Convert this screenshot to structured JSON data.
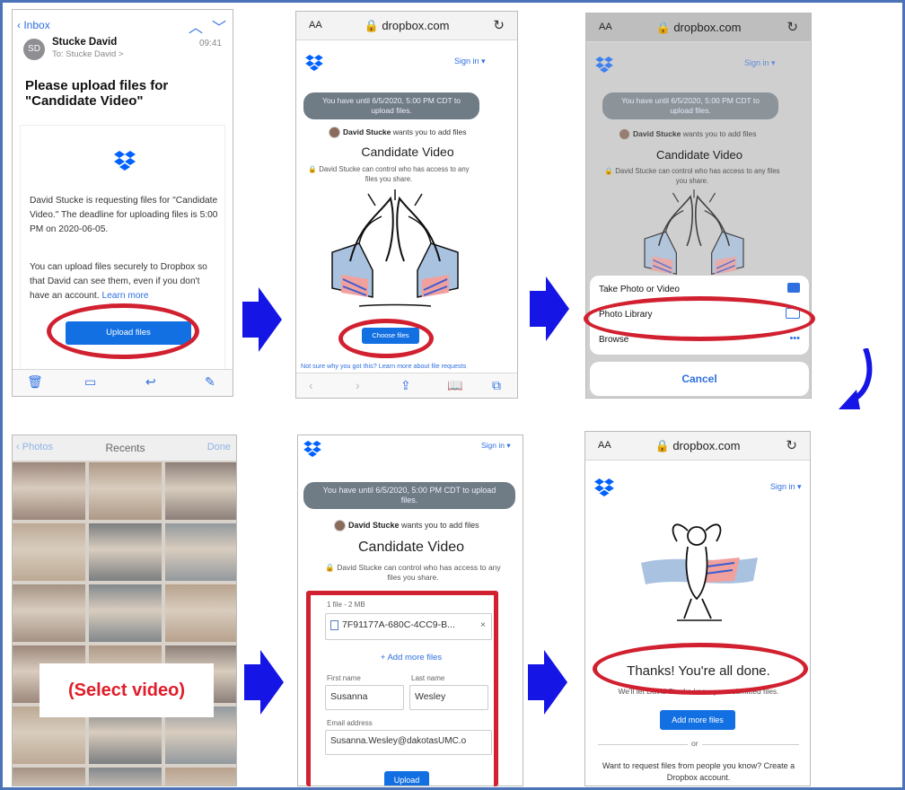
{
  "colors": {
    "accent": "#1270e3",
    "highlight": "#d1202f",
    "arrow": "#1515e6",
    "border": "#4c73b8"
  },
  "mail": {
    "back_label": "Inbox",
    "sender_initials": "SD",
    "sender": "Stucke David",
    "time": "09:41",
    "to": "To: Stucke David >",
    "subject": "Please upload files for \"Candidate Video\"",
    "body1": "David Stucke is requesting files for \"Candidate Video.\" The deadline for uploading files is 5:00 PM on 2020-06-05.",
    "body2": "You can upload files securely to Dropbox so that David can see them, even if you don't have an account.",
    "learn_more": "Learn more",
    "upload_btn": "Upload files"
  },
  "browser": {
    "aa": "AA",
    "url": "dropbox.com"
  },
  "request": {
    "signin": "Sign in ▾",
    "deadline": "You have until 6/5/2020, 5:00 PM CDT to upload files.",
    "owner": "David Stucke",
    "owner_suffix": "wants you to add files",
    "title": "Candidate Video",
    "access_note": "David Stucke can control who has access to any files you share.",
    "choose_btn": "Choose files",
    "footer_link": "Not sure why you got this? Learn more about file requests"
  },
  "sheet": {
    "take_photo": "Take Photo or Video",
    "photo_library": "Photo Library",
    "browse": "Browse",
    "more": "•••",
    "cancel": "Cancel"
  },
  "photos": {
    "back": "Photos",
    "title": "Recents",
    "done": "Done",
    "select_caption": "(Select video)"
  },
  "form": {
    "file_count": "1 file - 2 MB",
    "file_name": "7F91177A-680C-4CC9-B...",
    "remove": "×",
    "add_more": "+ Add more files",
    "first_label": "First name",
    "last_label": "Last name",
    "first_value": "Susanna",
    "last_value": "Wesley",
    "email_label": "Email address",
    "email_value": "Susanna.Wesley@dakotasUMC.o",
    "upload_btn": "Upload"
  },
  "done": {
    "thanks": "Thanks! You're all done.",
    "sub": "We'll let David Stucke know you submitted files.",
    "add_more_btn": "Add more files",
    "or": "or",
    "request_note": "Want to request files from people you know? Create a Dropbox account."
  }
}
